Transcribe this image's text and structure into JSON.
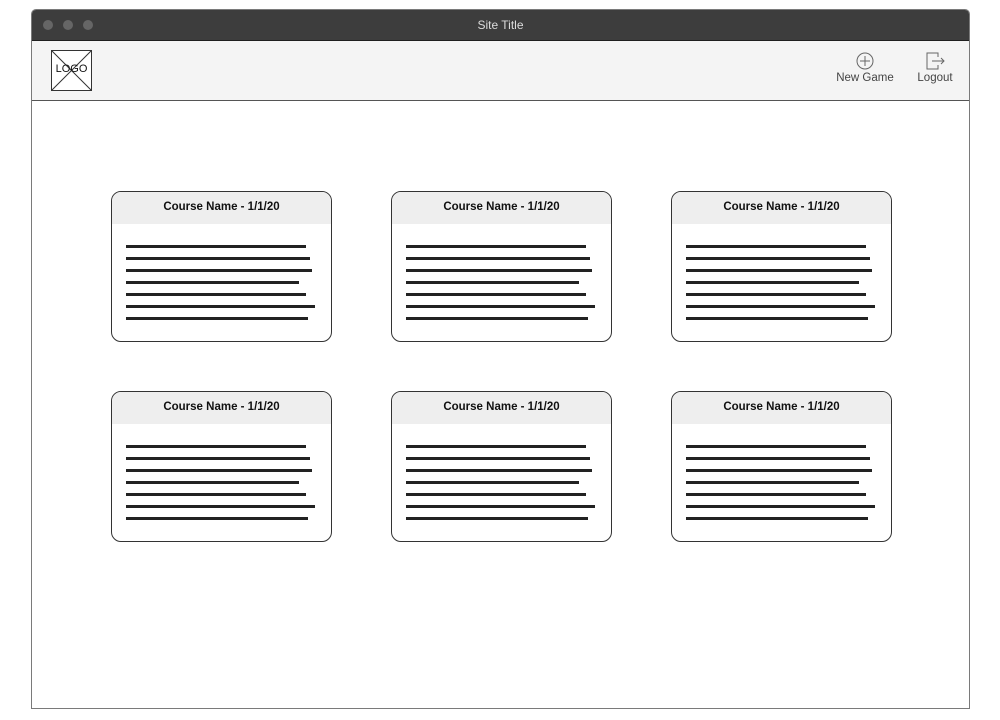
{
  "window": {
    "title": "Site Title"
  },
  "header": {
    "logo_text": "LOGO",
    "new_game_label": "New Game",
    "logout_label": "Logout",
    "icons": {
      "new_game": "plus-circle-icon",
      "logout": "logout-icon"
    }
  },
  "cards": [
    {
      "title": "Course Name - 1/1/20"
    },
    {
      "title": "Course Name - 1/1/20"
    },
    {
      "title": "Course Name - 1/1/20"
    },
    {
      "title": "Course Name - 1/1/20"
    },
    {
      "title": "Course Name - 1/1/20"
    },
    {
      "title": "Course Name - 1/1/20"
    }
  ],
  "colors": {
    "titlebar": "#3d3d3d",
    "header_bg": "#f4f4f4",
    "card_header_bg": "#eeeeee",
    "text_line": "#222222"
  }
}
